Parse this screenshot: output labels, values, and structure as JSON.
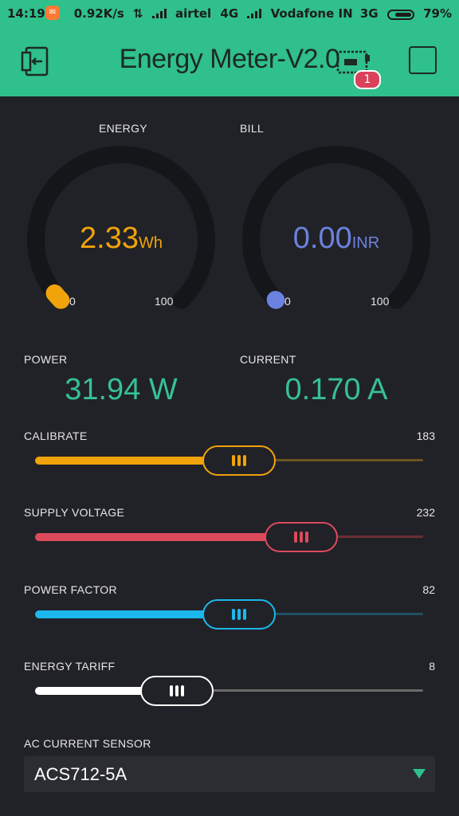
{
  "status_bar": {
    "time": "14:19",
    "speed": "0.92K/s",
    "carrier1": "airtel",
    "network1": "4G",
    "carrier2": "Vodafone IN",
    "network2": "3G",
    "battery": "79%",
    "battery_level": 0.79
  },
  "header": {
    "title": "Energy Meter-V2.0",
    "badge_count": "1",
    "background": "#2fc08b"
  },
  "gauges": [
    {
      "label": "ENERGY",
      "value": "2.33",
      "unit": "Wh",
      "min": "0",
      "max": "100",
      "level": 0.0233,
      "color": "#f0a30a"
    },
    {
      "label": "BILL",
      "value": "0.00",
      "unit": "INR",
      "min": "0",
      "max": "100",
      "level": 0.0,
      "color": "#6c82e0"
    }
  ],
  "displays": [
    {
      "label": "POWER",
      "value": "31.94 W"
    },
    {
      "label": "CURRENT",
      "value": "0.170 A"
    }
  ],
  "sliders": [
    {
      "label": "CALIBRATE",
      "value": "183",
      "level": 0.48,
      "color": "#f0a30a",
      "track_color": "#6b5320"
    },
    {
      "label": "SUPPLY VOLTAGE",
      "value": "232",
      "level": 0.64,
      "color": "#dd4a5e",
      "track_color": "#6b2e36"
    },
    {
      "label": "POWER FACTOR",
      "value": "82",
      "level": 0.48,
      "color": "#1cb8ec",
      "track_color": "#1f5266"
    },
    {
      "label": "ENERGY TARIFF",
      "value": "8",
      "level": 0.32,
      "color": "#ffffff",
      "track_color": "#6a6a6a"
    }
  ],
  "sensor_menu": {
    "label": "AC CURRENT SENSOR",
    "selected": "ACS712-5A",
    "accent": "#2fc08b"
  },
  "icons": [
    "exit-icon",
    "device-board-icon",
    "square-icon",
    "dropdown-arrow-icon",
    "slider-grip-icon"
  ]
}
